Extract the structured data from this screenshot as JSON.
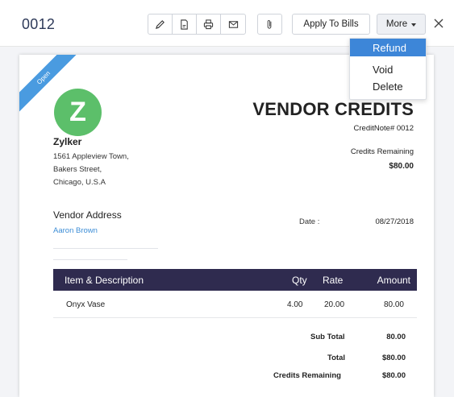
{
  "header": {
    "doc_number": "0012",
    "apply_label": "Apply To Bills",
    "more_label": "More"
  },
  "toolbar": {
    "icons": [
      "edit-icon",
      "pdf-icon",
      "print-icon",
      "email-icon",
      "attachment-icon",
      "close-icon"
    ]
  },
  "more_menu": {
    "items": [
      {
        "label": "Refund",
        "active": true
      },
      {
        "label": "Void",
        "active": false
      },
      {
        "label": "Delete",
        "active": false
      }
    ]
  },
  "document": {
    "status_ribbon": "Open",
    "logo_letter": "Z",
    "title": "VENDOR CREDITS",
    "credit_note": "CreditNote# 0012",
    "credits_remaining_label": "Credits Remaining",
    "credits_remaining_value": "$80.00",
    "org": {
      "name": "Zylker",
      "address": [
        "1561 Appleview Town,",
        "Bakers Street,",
        "Chicago, U.S.A"
      ]
    },
    "vendor_address_label": "Vendor Address",
    "vendor_name": "Aaron Brown",
    "date_label": "Date :",
    "date_value": "08/27/2018",
    "table": {
      "headers": {
        "item": "Item & Description",
        "qty": "Qty",
        "rate": "Rate",
        "amount": "Amount"
      },
      "rows": [
        {
          "item": "Onyx Vase",
          "qty": "4.00",
          "rate": "20.00",
          "amount": "80.00"
        }
      ]
    },
    "totals": {
      "sub_total_label": "Sub Total",
      "sub_total_value": "80.00",
      "total_label": "Total",
      "total_value": "$80.00",
      "credits_remaining_label": "Credits Remaining",
      "credits_remaining_value": "$80.00"
    }
  },
  "colors": {
    "accent": "#3d86d8",
    "table_header": "#2f2b4f",
    "logo": "#5cbf6a",
    "ribbon": "#4a9be0"
  }
}
